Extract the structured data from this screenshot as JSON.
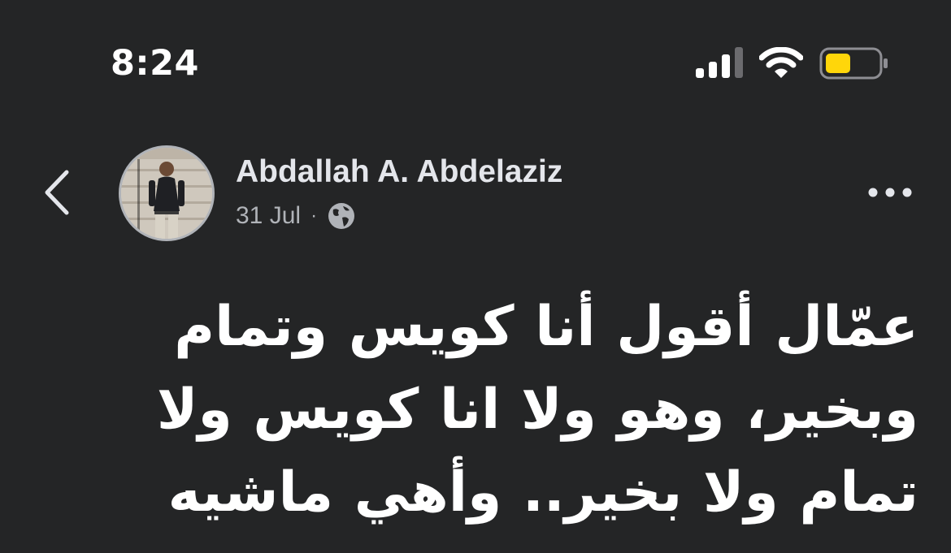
{
  "status_bar": {
    "time": "8:24",
    "icons": [
      "cellular-signal-icon",
      "wifi-icon",
      "battery-icon"
    ],
    "battery_color": "#ffd60a"
  },
  "post": {
    "author": "Abdallah A. Abdelaziz",
    "date": "31 Jul",
    "separator": "·",
    "privacy_icon": "globe-icon",
    "text": "عمّال أقول أنا كويس وتمام وبخير، وهو ولا انا كويس ولا تمام ولا بخير.. وأهي ماشيه"
  },
  "icons": {
    "back": "chevron-left-icon",
    "more": "more-options-icon"
  },
  "colors": {
    "background": "#242526",
    "primary_text": "#ffffff",
    "secondary_text": "#b0b3b8"
  }
}
